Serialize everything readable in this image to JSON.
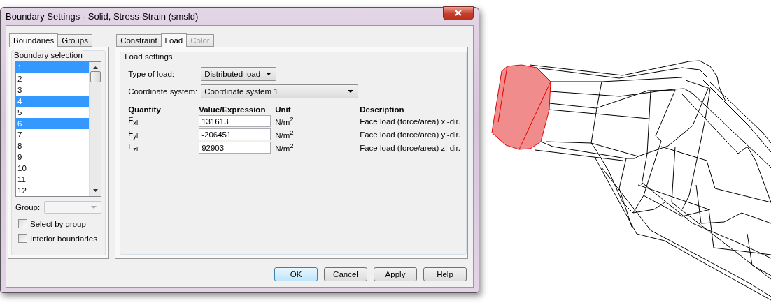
{
  "window": {
    "title": "Boundary Settings - Solid, Stress-Strain (smsld)"
  },
  "left_tabs": [
    {
      "label": "Boundaries",
      "selected": true
    },
    {
      "label": "Groups",
      "selected": false
    }
  ],
  "boundary_selection": {
    "title": "Boundary selection",
    "items": [
      {
        "label": "1",
        "selected": true
      },
      {
        "label": "2",
        "selected": false
      },
      {
        "label": "3",
        "selected": false
      },
      {
        "label": "4",
        "selected": true
      },
      {
        "label": "5",
        "selected": false
      },
      {
        "label": "6",
        "selected": true
      },
      {
        "label": "7",
        "selected": false
      },
      {
        "label": "8",
        "selected": false
      },
      {
        "label": "9",
        "selected": false
      },
      {
        "label": "10",
        "selected": false
      },
      {
        "label": "11",
        "selected": false
      },
      {
        "label": "12",
        "selected": false
      }
    ]
  },
  "group": {
    "label": "Group:",
    "disabled": true
  },
  "checkboxes": [
    {
      "label": "Select by group",
      "checked": false
    },
    {
      "label": "Interior boundaries",
      "checked": false
    }
  ],
  "right_tabs": [
    {
      "label": "Constraint",
      "selected": false,
      "disabled": false
    },
    {
      "label": "Load",
      "selected": true,
      "disabled": false
    },
    {
      "label": "Color",
      "selected": false,
      "disabled": true
    }
  ],
  "load_settings": {
    "title": "Load settings",
    "type_of_load": {
      "label": "Type of load:",
      "value": "Distributed load"
    },
    "coordinate_system": {
      "label": "Coordinate system:",
      "value": "Coordinate system 1"
    },
    "columns": [
      "Quantity",
      "Value/Expression",
      "Unit",
      "Description"
    ],
    "rows": [
      {
        "quantity": "F$_{xl}$",
        "value": "131613",
        "unit": "N/m$^{2}$",
        "description": "Face load (force/area) xl-dir."
      },
      {
        "quantity": "F$_{yl}$",
        "value": "-206451",
        "unit": "N/m$^{2}$",
        "description": "Face load (force/area) yl-dir."
      },
      {
        "quantity": "F$_{zl}$",
        "value": "92903",
        "unit": "N/m$^{2}$",
        "description": "Face load (force/area) zl-dir."
      }
    ]
  },
  "buttons": [
    {
      "label": "OK",
      "default": true
    },
    {
      "label": "Cancel",
      "default": false
    },
    {
      "label": "Apply",
      "default": false
    },
    {
      "label": "Help",
      "default": false
    }
  ]
}
